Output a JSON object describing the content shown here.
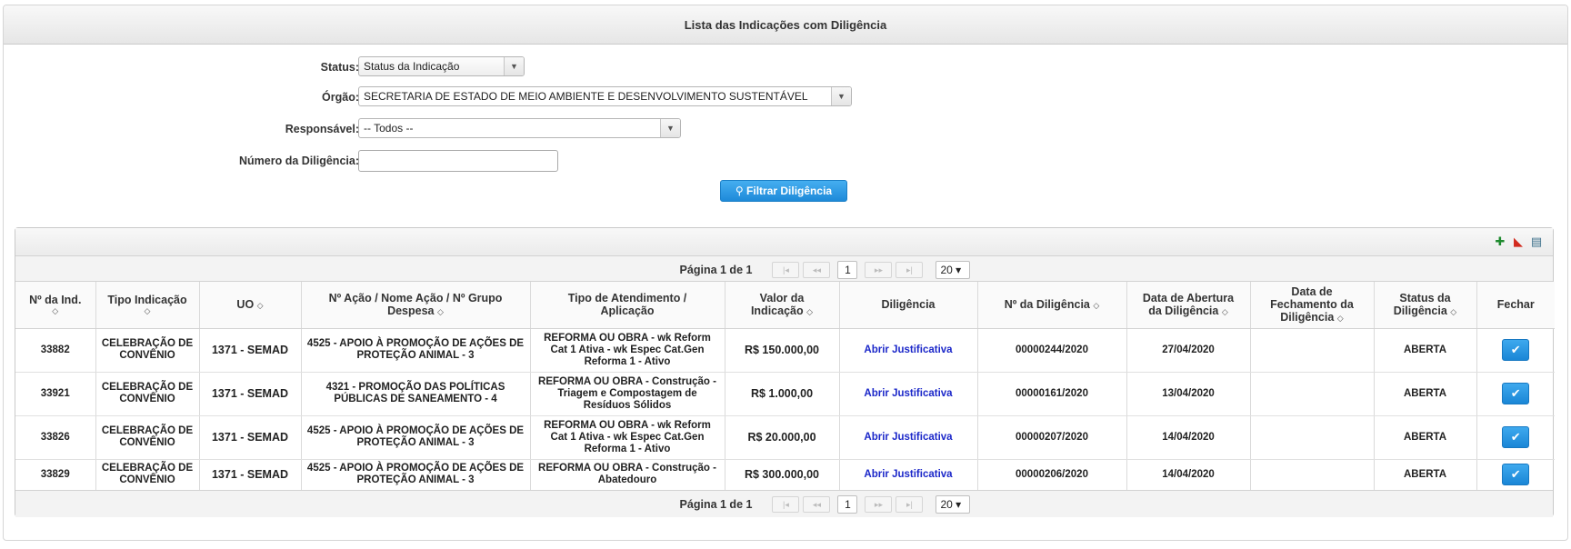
{
  "header": {
    "title": "Lista das Indicações com Diligência"
  },
  "filters": {
    "status": {
      "label": "Status:",
      "value": "Status da Indicação"
    },
    "orgao": {
      "label": "Órgão:",
      "value": "SECRETARIA DE ESTADO DE MEIO AMBIENTE E DESENVOLVIMENTO SUSTENTÁVEL"
    },
    "responsavel": {
      "label": "Responsável:",
      "value": "-- Todos --"
    },
    "numero": {
      "label": "Número da Diligência:",
      "value": ""
    },
    "button_label": "Filtrar Diligência"
  },
  "toolbar": {
    "icons": [
      "excel-icon",
      "pdf-icon",
      "print-icon"
    ]
  },
  "pager": {
    "text": "Página 1 de 1",
    "page": "1",
    "page_size": "20"
  },
  "columns": [
    {
      "line1": "Nº da Ind.",
      "line2": ""
    },
    {
      "line1": "Tipo Indicação",
      "line2": ""
    },
    {
      "line1": "UO",
      "line2": ""
    },
    {
      "line1": "Nº Ação / Nome Ação / Nº Grupo",
      "line2": "Despesa"
    },
    {
      "line1": "Tipo de Atendimento /",
      "line2": "Aplicação"
    },
    {
      "line1": "Valor da",
      "line2": "Indicação"
    },
    {
      "line1": "Diligência",
      "line2": ""
    },
    {
      "line1": "Nº da Diligência",
      "line2": ""
    },
    {
      "line1": "Data de Abertura",
      "line2": "da Diligência"
    },
    {
      "line1": "Data de",
      "line2": "Fechamento da",
      "line3": "Diligência"
    },
    {
      "line1": "Status da",
      "line2": "Diligência"
    },
    {
      "line1": "Fechar",
      "line2": ""
    }
  ],
  "rows": [
    {
      "num": "33882",
      "tipo": "CELEBRAÇÃO DE CONVÊNIO",
      "uo": "1371 - SEMAD",
      "acao": "4525 - APOIO À PROMOÇÃO DE AÇÕES DE PROTEÇÃO ANIMAL - 3",
      "atendimento": "REFORMA OU OBRA - wk Reform Cat 1 Ativa - wk Espec Cat.Gen Reforma 1 - Ativo",
      "valor": "R$ 150.000,00",
      "diligencia": "Abrir Justificativa",
      "num_dil": "00000244/2020",
      "abertura": "27/04/2020",
      "fechamento": "",
      "status": "ABERTA"
    },
    {
      "num": "33921",
      "tipo": "CELEBRAÇÃO DE CONVÊNIO",
      "uo": "1371 - SEMAD",
      "acao": "4321 - PROMOÇÃO DAS POLÍTICAS PÚBLICAS DE SANEAMENTO - 4",
      "atendimento": "REFORMA OU OBRA - Construção - Triagem e Compostagem de Resíduos Sólidos",
      "valor": "R$ 1.000,00",
      "diligencia": "Abrir Justificativa",
      "num_dil": "00000161/2020",
      "abertura": "13/04/2020",
      "fechamento": "",
      "status": "ABERTA"
    },
    {
      "num": "33826",
      "tipo": "CELEBRAÇÃO DE CONVÊNIO",
      "uo": "1371 - SEMAD",
      "acao": "4525 - APOIO À PROMOÇÃO DE AÇÕES DE PROTEÇÃO ANIMAL - 3",
      "atendimento": "REFORMA OU OBRA - wk Reform Cat 1 Ativa - wk Espec Cat.Gen Reforma 1 - Ativo",
      "valor": "R$ 20.000,00",
      "diligencia": "Abrir Justificativa",
      "num_dil": "00000207/2020",
      "abertura": "14/04/2020",
      "fechamento": "",
      "status": "ABERTA"
    },
    {
      "num": "33829",
      "tipo": "CELEBRAÇÃO DE CONVÊNIO",
      "uo": "1371 - SEMAD",
      "acao": "4525 - APOIO À PROMOÇÃO DE AÇÕES DE PROTEÇÃO ANIMAL - 3",
      "atendimento": "REFORMA OU OBRA - Construção - Abatedouro",
      "valor": "R$ 300.000,00",
      "diligencia": "Abrir Justificativa",
      "num_dil": "00000206/2020",
      "abertura": "14/04/2020",
      "fechamento": "",
      "status": "ABERTA"
    }
  ]
}
